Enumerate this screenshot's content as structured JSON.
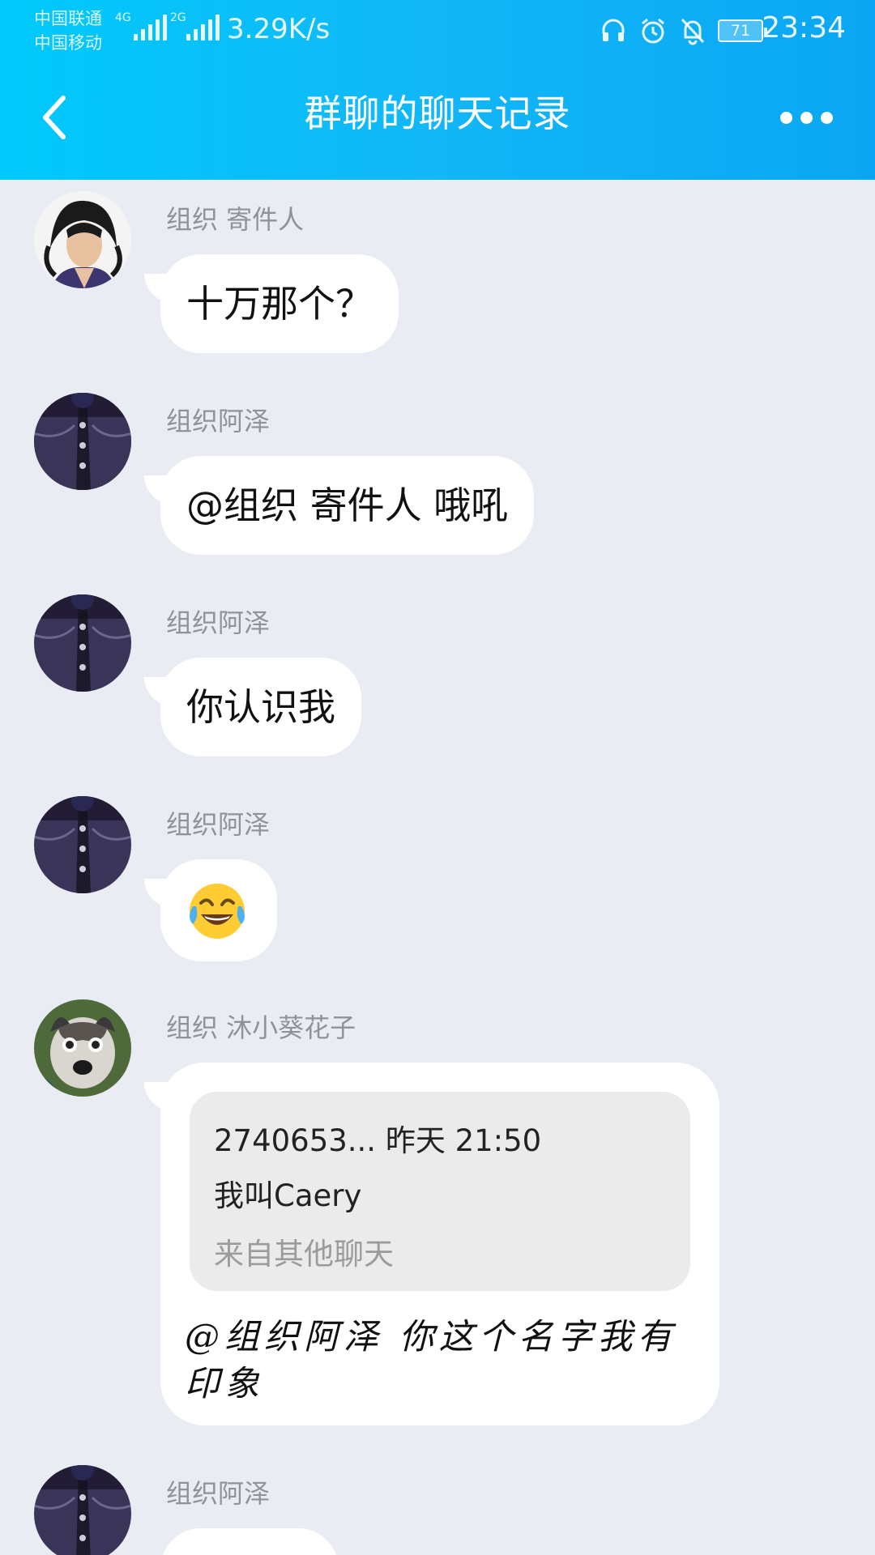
{
  "status_bar": {
    "carrier_1": "中国联通",
    "carrier_2": "中国移动",
    "net_1": "4G",
    "net_2": "2G",
    "speed": "3.29K/s",
    "battery": "71",
    "time": "23:34",
    "icons": [
      "headset-icon",
      "alarm-icon",
      "mute-bell-icon",
      "battery-icon"
    ]
  },
  "header": {
    "title": "群聊的聊天记录",
    "back_icon": "chevron-left-icon",
    "more_icon": "more-dots-icon"
  },
  "messages": [
    {
      "sender": "组织 寄件人",
      "text": "十万那个？",
      "avatar": "anime-long-hair"
    },
    {
      "sender": "组织阿泽",
      "text": "@组织 寄件人 哦吼",
      "avatar": "denim-jacket"
    },
    {
      "sender": "组织阿泽",
      "text": "你认识我",
      "avatar": "denim-jacket"
    },
    {
      "sender": "组织阿泽",
      "text": "😂",
      "avatar": "denim-jacket"
    },
    {
      "sender": "组织 沐小葵花子",
      "avatar": "husky-dog",
      "quote": {
        "meta": "2740653...  昨天 21:50",
        "text": "我叫Caery",
        "source": "来自其他聊天"
      },
      "text": "@组织阿泽 你这个名字我有印象"
    },
    {
      "sender": "组织阿泽",
      "text": "",
      "avatar": "denim-jacket"
    }
  ],
  "colors": {
    "header_gradient_start": "#00c9fb",
    "header_gradient_end": "#0aa6f3",
    "background": "#eaecf3",
    "bubble": "#ffffff",
    "quote_box": "#ebebeb",
    "sender_name": "#8e9299"
  }
}
